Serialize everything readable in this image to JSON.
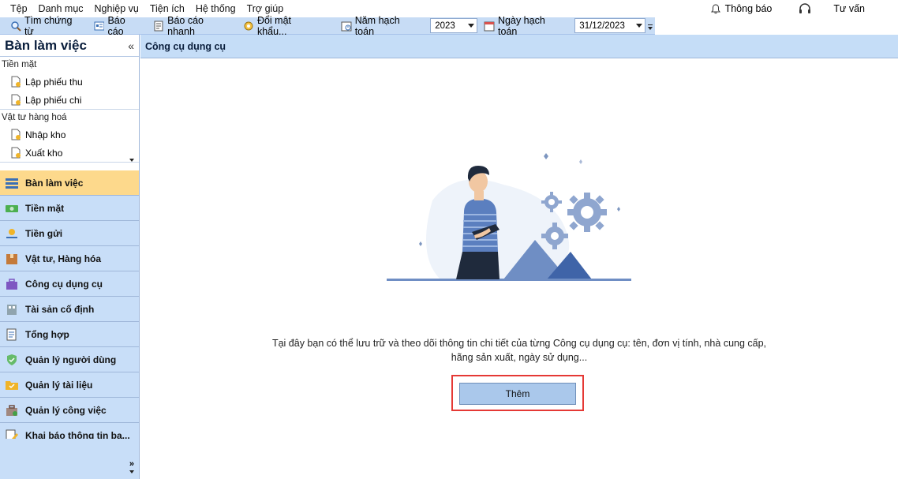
{
  "menu": {
    "items": [
      "Tệp",
      "Danh mục",
      "Nghiệp vụ",
      "Tiện ích",
      "Hệ thống",
      "Trợ giúp"
    ],
    "notifications": "Thông báo",
    "advice": "Tư vấn"
  },
  "toolbar": {
    "find_voucher": "Tìm chứng từ",
    "report": "Báo cáo",
    "quick_report": "Báo cáo nhanh",
    "change_password": "Đổi mật khẩu...",
    "fiscal_year_label": "Năm hạch toán",
    "fiscal_year_value": "2023",
    "posting_date_label": "Ngày hạch toán",
    "posting_date_value": "31/12/2023"
  },
  "sidebar": {
    "title": "Bàn làm việc",
    "groups": [
      {
        "title": "Tiền mặt",
        "items": [
          "Lập phiếu thu",
          "Lập phiếu chi"
        ]
      },
      {
        "title": "Vật tư hàng hoá",
        "items": [
          "Nhập kho",
          "Xuất kho"
        ]
      }
    ],
    "nav": [
      "Bàn làm việc",
      "Tiền mặt",
      "Tiền gửi",
      "Vật tư, Hàng hóa",
      "Công cụ dụng cụ",
      "Tài sản cố định",
      "Tổng hợp",
      "Quản lý người dùng",
      "Quản lý tài liệu",
      "Quản lý công việc",
      "Khai báo thông tin ba..."
    ],
    "active_index": 0
  },
  "main": {
    "title": "Công cụ dụng cụ",
    "description": "Tại đây bạn có thể lưu trữ và theo dõi thông tin chi tiết của từng Công cụ dụng cụ: tên, đơn vị tính, nhà cung cấp, hãng sản xuất, ngày sử dụng...",
    "add_button": "Thêm"
  },
  "colors": {
    "accent": "#c5ddf7",
    "active_nav": "#fdd98c",
    "highlight": "#e53935"
  }
}
